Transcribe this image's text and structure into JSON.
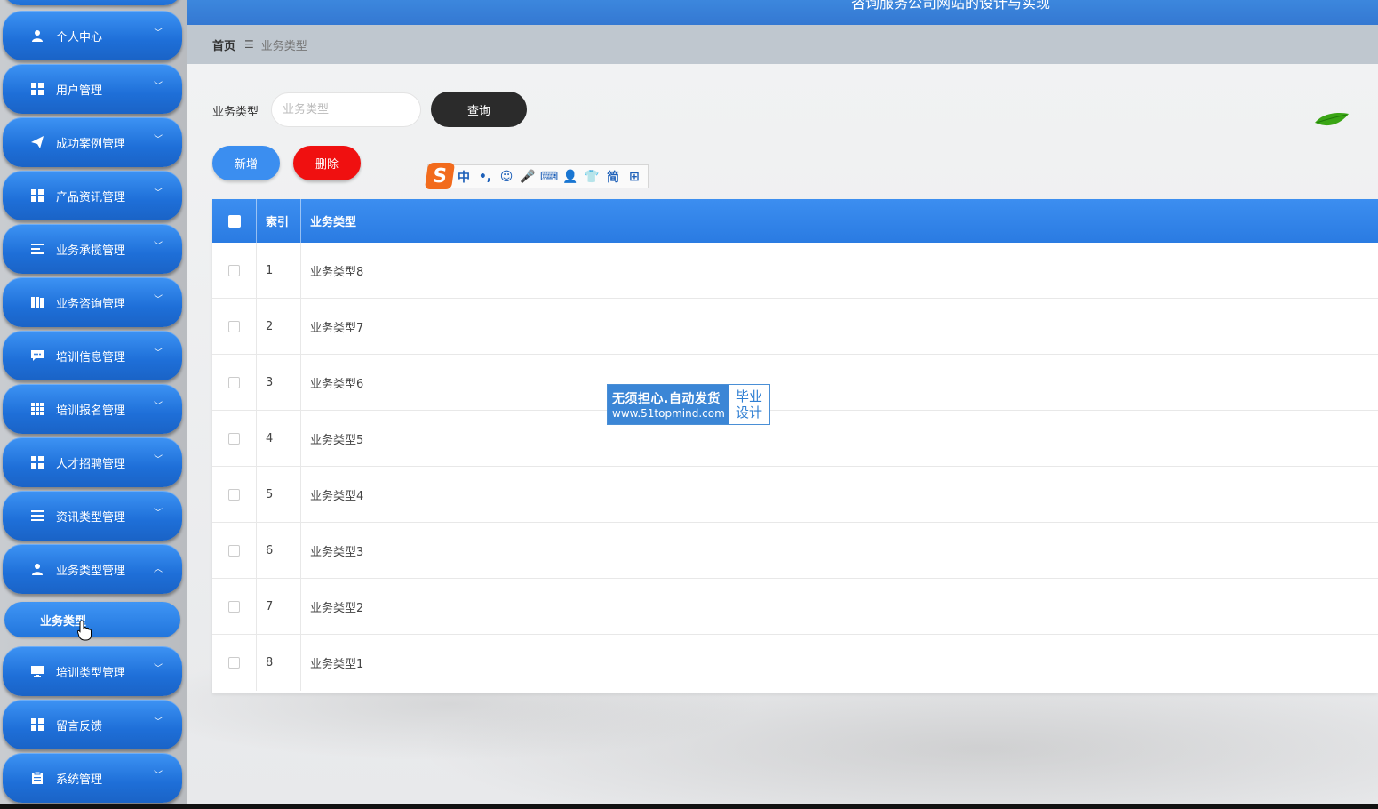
{
  "header": {
    "title": "咨询服务公司网站的设计与实现"
  },
  "breadcrumb": {
    "home": "首页",
    "separator": "☰",
    "current": "业务类型"
  },
  "sidebar": {
    "items": [
      {
        "label": "个人中心",
        "icon": "user-icon",
        "expanded": false
      },
      {
        "label": "用户管理",
        "icon": "grid-icon",
        "expanded": false
      },
      {
        "label": "成功案例管理",
        "icon": "paper-plane-icon",
        "expanded": false
      },
      {
        "label": "产品资讯管理",
        "icon": "grid-icon",
        "expanded": false
      },
      {
        "label": "业务承揽管理",
        "icon": "list-icon",
        "expanded": false
      },
      {
        "label": "业务咨询管理",
        "icon": "book-icon",
        "expanded": false
      },
      {
        "label": "培训信息管理",
        "icon": "chat-icon",
        "expanded": false
      },
      {
        "label": "培训报名管理",
        "icon": "table-icon",
        "expanded": false
      },
      {
        "label": "人才招聘管理",
        "icon": "grid-icon",
        "expanded": false
      },
      {
        "label": "资讯类型管理",
        "icon": "list-icon",
        "expanded": false
      },
      {
        "label": "业务类型管理",
        "icon": "user-icon",
        "expanded": true
      },
      {
        "label": "培训类型管理",
        "icon": "monitor-icon",
        "expanded": false
      },
      {
        "label": "留言反馈",
        "icon": "grid-icon",
        "expanded": false
      },
      {
        "label": "系统管理",
        "icon": "clipboard-icon",
        "expanded": false
      }
    ],
    "sub_item": "业务类型"
  },
  "search": {
    "label": "业务类型",
    "placeholder": "业务类型",
    "value": "",
    "query_button": "查询"
  },
  "actions": {
    "add": "新增",
    "delete": "删除"
  },
  "ime": {
    "logo": "S",
    "buttons": [
      "中",
      "•,",
      "☺",
      "🎤",
      "⌨",
      "👤",
      "👕",
      "简",
      "⊞"
    ]
  },
  "table": {
    "columns": [
      "索引",
      "业务类型"
    ],
    "rows": [
      {
        "index": "1",
        "name": "业务类型8"
      },
      {
        "index": "2",
        "name": "业务类型7"
      },
      {
        "index": "3",
        "name": "业务类型6"
      },
      {
        "index": "4",
        "name": "业务类型5"
      },
      {
        "index": "5",
        "name": "业务类型4"
      },
      {
        "index": "6",
        "name": "业务类型3"
      },
      {
        "index": "7",
        "name": "业务类型2"
      },
      {
        "index": "8",
        "name": "业务类型1"
      }
    ]
  },
  "watermark": {
    "line1": "无须担心.自动发货",
    "line2": "www.51topmind.com",
    "right1": "毕业",
    "right2": "设计"
  },
  "colors": {
    "primary": "#2a7be2",
    "danger": "#f01010",
    "dark": "#2b2b2b",
    "sidebar_bg": "#c4c7cb"
  }
}
